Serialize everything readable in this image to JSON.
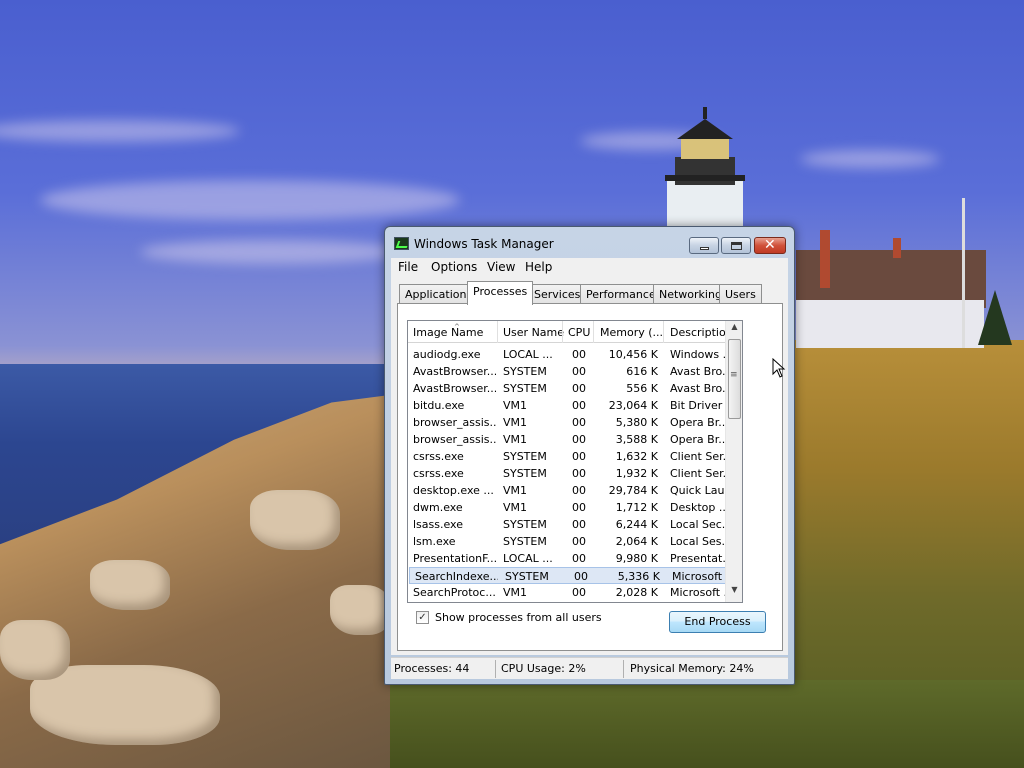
{
  "window": {
    "title": "Windows Task Manager"
  },
  "menu": [
    "File",
    "Options",
    "View",
    "Help"
  ],
  "tabs": [
    "Applications",
    "Processes",
    "Services",
    "Performance",
    "Networking",
    "Users"
  ],
  "active_tab": "Processes",
  "columns": [
    "Image Name",
    "User Name",
    "CPU",
    "Memory (...",
    "Description"
  ],
  "rows": [
    [
      "audiodg.exe",
      "LOCAL ...",
      "00",
      "10,456 K",
      "Windows ..."
    ],
    [
      "AvastBrowser...",
      "SYSTEM",
      "00",
      "616 K",
      "Avast Bro..."
    ],
    [
      "AvastBrowser...",
      "SYSTEM",
      "00",
      "556 K",
      "Avast Bro..."
    ],
    [
      "bitdu.exe",
      "VM1",
      "00",
      "23,064 K",
      "Bit Driver ..."
    ],
    [
      "browser_assis...",
      "VM1",
      "00",
      "5,380 K",
      "Opera Br..."
    ],
    [
      "browser_assis...",
      "VM1",
      "00",
      "3,588 K",
      "Opera Br..."
    ],
    [
      "csrss.exe",
      "SYSTEM",
      "00",
      "1,632 K",
      "Client Ser..."
    ],
    [
      "csrss.exe",
      "SYSTEM",
      "00",
      "1,932 K",
      "Client Ser..."
    ],
    [
      "desktop.exe ...",
      "VM1",
      "00",
      "29,784 K",
      "Quick Lau..."
    ],
    [
      "dwm.exe",
      "VM1",
      "00",
      "1,712 K",
      "Desktop ..."
    ],
    [
      "lsass.exe",
      "SYSTEM",
      "00",
      "6,244 K",
      "Local Sec..."
    ],
    [
      "lsm.exe",
      "SYSTEM",
      "00",
      "2,064 K",
      "Local Ses..."
    ],
    [
      "PresentationF...",
      "LOCAL ...",
      "00",
      "9,980 K",
      "Presentat..."
    ],
    [
      "SearchIndexe...",
      "SYSTEM",
      "00",
      "5,336 K",
      "Microsoft ..."
    ],
    [
      "SearchProtoc...",
      "VM1",
      "00",
      "2,028 K",
      "Microsoft ..."
    ]
  ],
  "selected_row": "SearchIndexe...",
  "show_all_label": "Show processes from all users",
  "show_all_checked": "✓",
  "end_process_label": "End Process",
  "status": {
    "processes": "Processes: 44",
    "cpu": "CPU Usage: 2%",
    "memory": "Physical Memory: 24%"
  },
  "icons": {
    "close": "✕",
    "scroll_up": "▲",
    "scroll_down": "▼",
    "sort": "^"
  }
}
